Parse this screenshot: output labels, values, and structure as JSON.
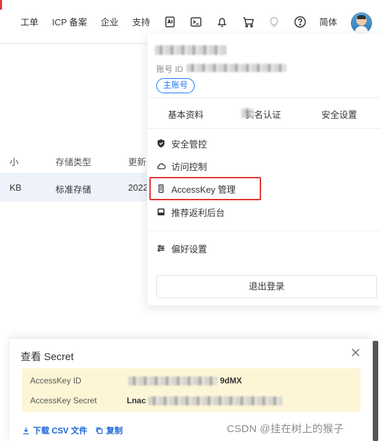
{
  "topnav": {
    "items": [
      "工单",
      "ICP 备案",
      "企业",
      "支持"
    ],
    "icons": [
      "api-icon",
      "terminal-icon",
      "bell-icon",
      "cart-icon",
      "lightbulb-icon",
      "help-icon"
    ],
    "lang": "简体"
  },
  "background_table": {
    "headers": [
      "小",
      "存储类型",
      "更新时"
    ],
    "row": [
      "KB",
      "标准存储",
      "2022"
    ]
  },
  "account_menu": {
    "account_id_label": "账号 ID",
    "account_id_value": "9dMX",
    "badge": "主账号",
    "tabs": [
      "基本资料",
      "实名认证",
      "安全设置"
    ],
    "items": [
      {
        "label": "安全管控",
        "icon": "shield-icon"
      },
      {
        "label": "访问控制",
        "icon": "cloud-icon"
      },
      {
        "label": "AccessKey 管理",
        "icon": "key-icon",
        "highlighted": true
      },
      {
        "label": "推荐返利后台",
        "icon": "monitor-icon"
      },
      {
        "label": "偏好设置",
        "icon": "sliders-icon"
      }
    ],
    "logout": "退出登录"
  },
  "secret_panel": {
    "title": "查看 Secret",
    "rows": [
      {
        "label": "AccessKey ID",
        "value_tail": "9dMX"
      },
      {
        "label": "AccessKey Secret",
        "value_head": "Lnac"
      }
    ],
    "links": [
      {
        "label": "下载 CSV 文件",
        "icon": "download-icon"
      },
      {
        "label": "复制",
        "icon": "copy-icon"
      }
    ]
  },
  "watermark": "CSDN @挂在树上的猴子",
  "colors": {
    "accent_blue": "#1677ff",
    "highlight_red": "#e0342c",
    "secret_bg": "#fdf6d6",
    "link_blue": "#1a66d9"
  }
}
